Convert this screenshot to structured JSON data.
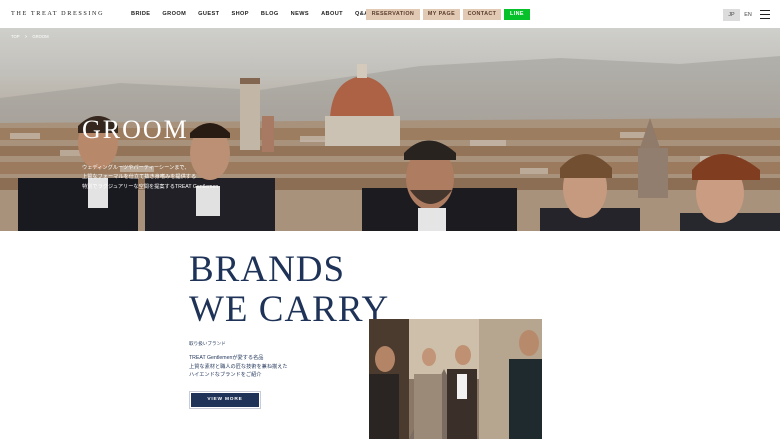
{
  "header": {
    "logo": "THE TREAT DRESSING",
    "nav": [
      "BRIDE",
      "GROOM",
      "GUEST",
      "SHOP",
      "BLOG",
      "NEWS",
      "ABOUT",
      "Q&A"
    ],
    "reservation": "RESERVATION",
    "mypage": "MY PAGE",
    "contact": "CONTACT",
    "line": "LINE",
    "lang_jp": "JP",
    "lang_en": "EN",
    "menu_icon": "hamburger-menu-icon"
  },
  "breadcrumb": {
    "home": "TOP",
    "separator": ">",
    "current": "GROOM"
  },
  "hero": {
    "title": "GROOM",
    "copy_line1": "ウェディングルーツやパーティーシーンまで、",
    "copy_line2": "上質なフォーマルを仕立て抜き身嗜みを提供する",
    "copy_line3": "特別でラグジュアリーな空間を提案するTREAT Gentlemen",
    "image_alt": "Groomsmen in tuxedos in front of Florence cathedral"
  },
  "brands": {
    "title_line1": "BRANDS",
    "title_line2": "WE CARRY",
    "label": "取り扱いブランド",
    "text_line1": "TREAT Gentlemenが愛する名品",
    "text_line2": "上質な素材と職人の匠な技術を兼ね揃えた",
    "text_line3": "ハイエンドなブランドをご紹介",
    "button": "VIEW MORE"
  },
  "colors": {
    "navy": "#1f3358",
    "beige_pill": "#e2c9b4",
    "line_green": "#06c12a"
  }
}
